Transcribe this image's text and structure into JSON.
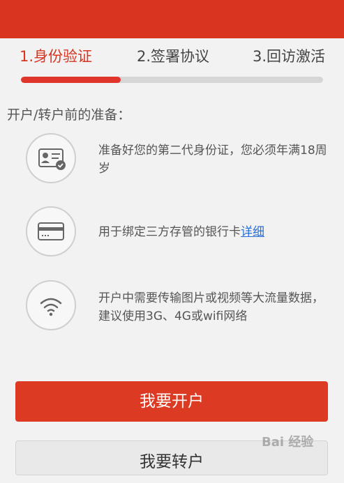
{
  "steps": [
    {
      "label": "1.身份验证",
      "active": true
    },
    {
      "label": "2.签署协议",
      "active": false
    },
    {
      "label": "3.回访激活",
      "active": false
    }
  ],
  "progress": {
    "fraction": 0.33
  },
  "section_title": "开户/转户前的准备：",
  "requirements": [
    {
      "icon": "id-card-icon",
      "text": "准备好您的第二代身份证，您必须年满18周岁"
    },
    {
      "icon": "bank-card-icon",
      "text": "用于绑定三方存管的银行卡",
      "link": "详细"
    },
    {
      "icon": "wifi-icon",
      "text": "开户中需要传输图片或视频等大流量数据，建议使用3G、4G或wifi网络"
    }
  ],
  "buttons": {
    "open_account": "我要开户",
    "transfer_account": "我要转户"
  },
  "watermark": "Bai 经验",
  "colors": {
    "accent": "#d9341f",
    "link": "#2a6fd6"
  }
}
